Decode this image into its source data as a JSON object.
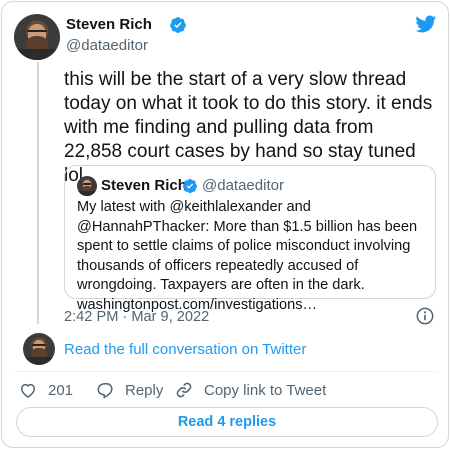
{
  "author": {
    "name": "Steven Rich",
    "handle": "@dataeditor"
  },
  "tweet": {
    "text": "this will be the start of a very slow thread today on what it took to do this story. it ends with me finding and pulling data from 22,858 court cases by hand so stay tuned lol",
    "timestamp": "2:42 PM · Mar 9, 2022"
  },
  "quote": {
    "name": "Steven Rich",
    "handle": "@dataeditor",
    "text": "My latest with @keithlalexander and @HannahPThacker: More than $1.5 billion has been spent to settle claims of police misconduct involving thousands of officers repeatedly accused of wrongdoing. Taxpayers are often in the dark. washingtonpost.com/investigations…"
  },
  "conversation": {
    "label": "Read the full conversation on Twitter"
  },
  "actions": {
    "like_count": "201",
    "reply_label": "Reply",
    "copy_label": "Copy link to Tweet"
  },
  "footer": {
    "read_replies_label": "Read 4 replies"
  },
  "icons": {
    "verified": "verified-badge-icon",
    "logo": "twitter-bird-icon",
    "info": "info-icon",
    "like": "heart-icon",
    "reply": "reply-bubble-icon",
    "copy": "link-icon"
  },
  "colors": {
    "accent": "#1d9bf0",
    "text": "#0f1419",
    "secondary": "#536471",
    "border": "#cfd9de"
  }
}
